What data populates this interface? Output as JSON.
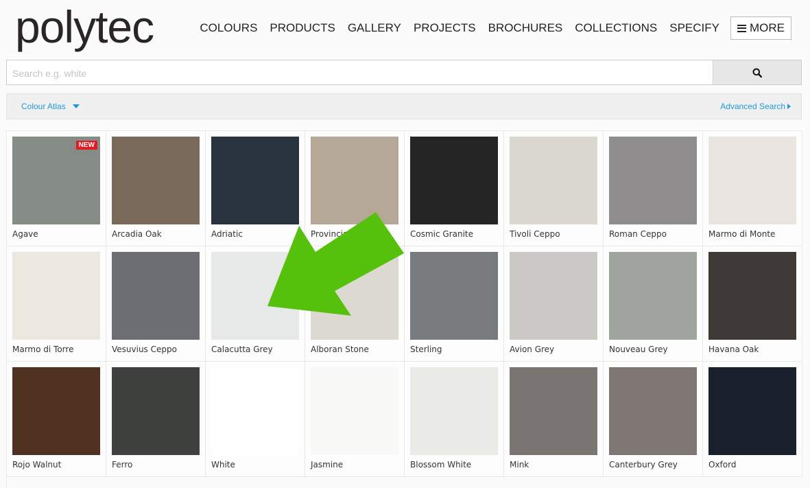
{
  "header": {
    "logo": "polytec",
    "nav": [
      "COLOURS",
      "PRODUCTS",
      "GALLERY",
      "PROJECTS",
      "BROCHURES",
      "COLLECTIONS",
      "SPECIFY"
    ],
    "more_label": "MORE"
  },
  "search": {
    "placeholder": "Search e.g. white"
  },
  "filter": {
    "colour_atlas": "Colour Atlas",
    "advanced_search": "Advanced Search"
  },
  "swatches": [
    {
      "name": "Agave",
      "badge": "NEW",
      "color": "#858c86"
    },
    {
      "name": "Arcadia Oak",
      "color": "#7a6a5a"
    },
    {
      "name": "Adriatic",
      "color": "#28333d"
    },
    {
      "name": "Provincial",
      "color": "#b6a897"
    },
    {
      "name": "Cosmic Granite",
      "color": "#262526"
    },
    {
      "name": "Tivoli Ceppo",
      "color": "#d9d7d0"
    },
    {
      "name": "Roman Ceppo",
      "color": "#8f8d8e"
    },
    {
      "name": "Marmo di Monte",
      "color": "#eae5e1"
    },
    {
      "name": "Marmo di Torre",
      "color": "#ece8e0"
    },
    {
      "name": "Vesuvius Ceppo",
      "color": "#6c6e73"
    },
    {
      "name": "Calacutta Grey",
      "color": "#e7e8e8"
    },
    {
      "name": "Alboran Stone",
      "color": "#dcd9d1"
    },
    {
      "name": "Sterling",
      "color": "#777b7d"
    },
    {
      "name": "Avion Grey",
      "color": "#cbc9c5"
    },
    {
      "name": "Nouveau Grey",
      "color": "#a0a59f"
    },
    {
      "name": "Havana Oak",
      "color": "#3f3a37"
    },
    {
      "name": "Rojo Walnut",
      "color": "#4f3222"
    },
    {
      "name": "Ferro",
      "color": "#3e413d"
    },
    {
      "name": "White",
      "color": "#ffffff"
    },
    {
      "name": "Jasmine",
      "color": "#f8f9f6"
    },
    {
      "name": "Blossom White",
      "color": "#eaeae6"
    },
    {
      "name": "Mink",
      "color": "#7a7573"
    },
    {
      "name": "Canterbury Grey",
      "color": "#7e7774"
    },
    {
      "name": "Oxford",
      "color": "#1a202b"
    }
  ]
}
